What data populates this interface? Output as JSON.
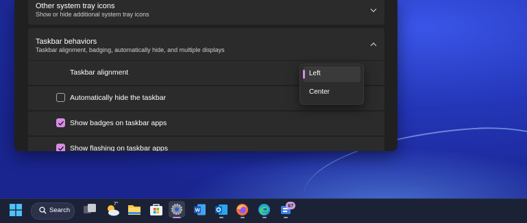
{
  "settings": {
    "system_tray": {
      "title": "Other system tray icons",
      "subtitle": "Show or hide additional system tray icons"
    },
    "taskbar_behaviors": {
      "title": "Taskbar behaviors",
      "subtitle": "Taskbar alignment, badging, automatically hide, and multiple displays"
    },
    "alignment": {
      "label": "Taskbar alignment",
      "options": [
        "Left",
        "Center"
      ],
      "selected": "Left"
    },
    "checkboxes": [
      {
        "label": "Automatically hide the taskbar",
        "checked": false
      },
      {
        "label": "Show badges on taskbar apps",
        "checked": true
      },
      {
        "label": "Show flashing on taskbar apps",
        "checked": true
      }
    ]
  },
  "taskbar": {
    "search_label": "Search",
    "weather_temp": "7°",
    "outlook_badge": "",
    "teams_badge": "67"
  },
  "colors": {
    "accent": "#d78ce4",
    "window_bg": "#202020",
    "card_bg": "#2b2b2b"
  }
}
